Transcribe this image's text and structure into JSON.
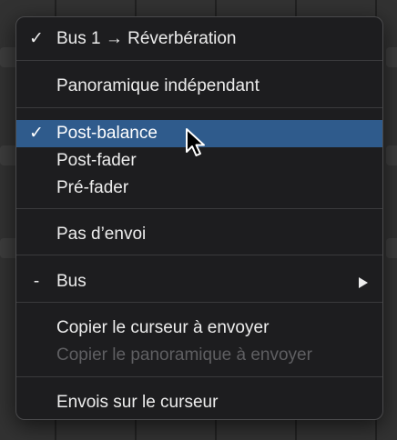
{
  "menu": {
    "items": [
      {
        "mark": "✓",
        "label": "Bus 1 → Réverbération"
      },
      {
        "mark": "",
        "label": "Panoramique indépendant"
      },
      {
        "mark": "✓",
        "label": "Post-balance"
      },
      {
        "mark": "",
        "label": "Post-fader"
      },
      {
        "mark": "",
        "label": "Pré-fader"
      },
      {
        "mark": "",
        "label": "Pas d’envoi"
      },
      {
        "mark": "-",
        "label": "Bus"
      },
      {
        "mark": "",
        "label": "Copier le curseur à envoyer"
      },
      {
        "mark": "",
        "label": "Copier le panoramique à envoyer"
      },
      {
        "mark": "",
        "label": "Envois sur le curseur"
      }
    ]
  },
  "colors": {
    "menu_background": "#1d1d1f",
    "highlight": "#2f5b8c",
    "text": "#ededed",
    "disabled_text": "#5f5f62"
  },
  "icons": {
    "pointer": "mouse-pointer-icon",
    "submenu": "chevron-right-icon"
  }
}
